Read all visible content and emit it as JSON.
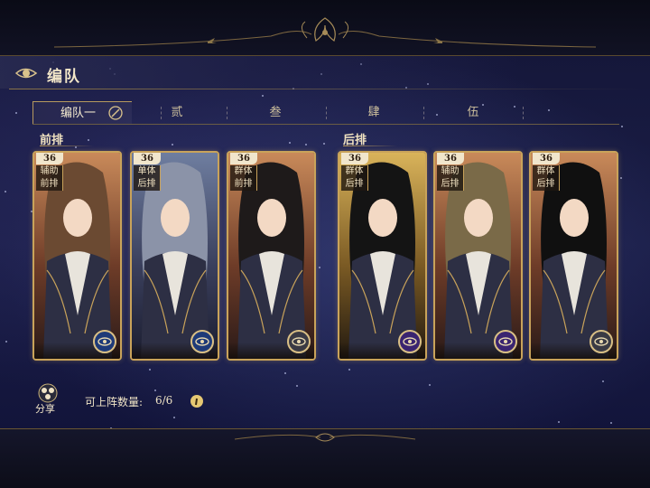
{
  "header": {
    "title": "编队"
  },
  "tabs": [
    {
      "label": "编队一",
      "active": true
    },
    {
      "label": "贰",
      "active": false
    },
    {
      "label": "叁",
      "active": false
    },
    {
      "label": "肆",
      "active": false
    },
    {
      "label": "伍",
      "active": false
    }
  ],
  "rows": {
    "front": "前排",
    "back": "后排"
  },
  "cards": [
    {
      "level": "36",
      "tags": [
        "辅助",
        "前排"
      ],
      "badge": "blue",
      "palette": "warm",
      "hair": "#6b4a32"
    },
    {
      "level": "36",
      "tags": [
        "单体",
        "后排"
      ],
      "badge": "blue",
      "palette": "cool",
      "hair": "#8b93a8"
    },
    {
      "level": "36",
      "tags": [
        "群体",
        "前排"
      ],
      "badge": "gray",
      "palette": "warm",
      "hair": "#1e1a1a"
    },
    {
      "level": "36",
      "tags": [
        "群体",
        "后排"
      ],
      "badge": "purple",
      "palette": "gold",
      "hair": "#141414"
    },
    {
      "level": "36",
      "tags": [
        "辅助",
        "后排"
      ],
      "badge": "purple",
      "palette": "warm",
      "hair": "#7a6a48"
    },
    {
      "level": "36",
      "tags": [
        "群体",
        "后排"
      ],
      "badge": "gray",
      "palette": "warm",
      "hair": "#101010"
    }
  ],
  "bottom": {
    "share_label": "分享",
    "count_label": "可上阵数量:",
    "count_value": "6/6"
  },
  "colors": {
    "gold": "#c9a35a",
    "bg": "#1b1e48"
  }
}
